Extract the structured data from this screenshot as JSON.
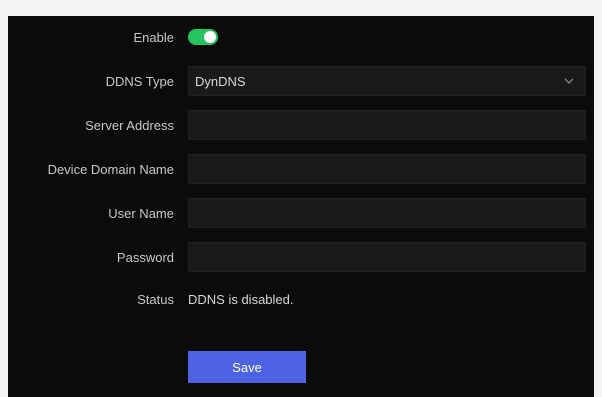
{
  "form": {
    "enable": {
      "label": "Enable",
      "value": true
    },
    "ddns_type": {
      "label": "DDNS Type",
      "value": "DynDNS"
    },
    "server_address": {
      "label": "Server Address",
      "value": ""
    },
    "device_domain_name": {
      "label": "Device Domain Name",
      "value": ""
    },
    "user_name": {
      "label": "User Name",
      "value": ""
    },
    "password": {
      "label": "Password",
      "value": ""
    },
    "status": {
      "label": "Status",
      "value": "DDNS is disabled."
    },
    "save_label": "Save"
  },
  "colors": {
    "toggle_on": "#22c55e",
    "save_button": "#4d63e3",
    "panel_background": "#0b0b0b"
  }
}
